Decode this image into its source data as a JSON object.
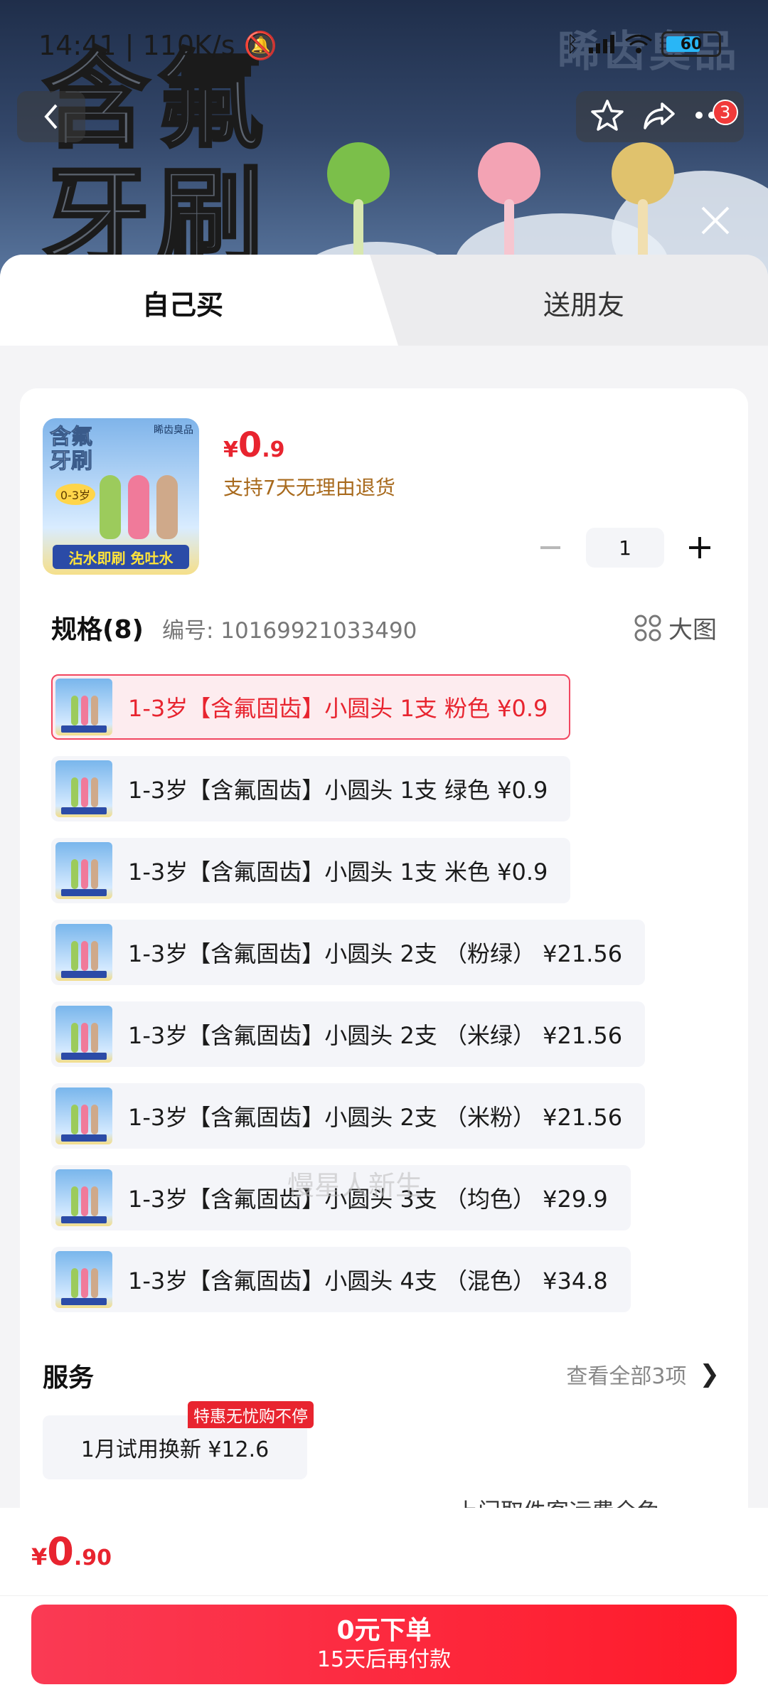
{
  "status_bar": {
    "time": "14:41",
    "speed": "110K/s",
    "battery": "60"
  },
  "banner": {
    "title_line1": "含氟",
    "title_line2": "牙刷",
    "brand": "睎齿臭品"
  },
  "nav": {
    "more_badge": "3"
  },
  "tabs": [
    {
      "label": "自己买"
    },
    {
      "label": "送朋友"
    }
  ],
  "product": {
    "price_currency": "¥",
    "price_int": "0",
    "price_dec": ".9",
    "return_policy": "支持7天无理由退货",
    "quantity": "1",
    "thumb_title_line1": "含氟",
    "thumb_title_line2": "牙刷",
    "thumb_age": "0-3岁",
    "thumb_brand": "睎齿臭品",
    "thumb_banner": "沾水即刷 免吐水"
  },
  "spec": {
    "title": "规格(8)",
    "code": "编号: 10169921033490",
    "big_image": "大图",
    "options": [
      {
        "label": "1-3岁【含氟固齿】小圆头 1支 粉色  ¥0.9"
      },
      {
        "label": "1-3岁【含氟固齿】小圆头 1支 绿色  ¥0.9"
      },
      {
        "label": "1-3岁【含氟固齿】小圆头 1支 米色  ¥0.9"
      },
      {
        "label": "1-3岁【含氟固齿】小圆头 2支 （粉绿）  ¥21.56"
      },
      {
        "label": "1-3岁【含氟固齿】小圆头 2支 （米绿）  ¥21.56"
      },
      {
        "label": "1-3岁【含氟固齿】小圆头 2支 （米粉）  ¥21.56"
      },
      {
        "label": "1-3岁【含氟固齿】小圆头 3支 （均色）  ¥29.9"
      },
      {
        "label": "1-3岁【含氟固齿】小圆头 4支 （混色）  ¥34.8"
      }
    ]
  },
  "watermark": "慢星人新生",
  "service": {
    "title": "服务",
    "view_all": "查看全部3项",
    "chip": "1月试用换新  ¥12.6",
    "tag": "特惠无忧购不停"
  },
  "bottom": {
    "peek_text": "上门取件客运费全免",
    "total_currency": "¥",
    "total_int": "0",
    "total_dec": ".90",
    "cta_main": "0元下单",
    "cta_sub": "15天后再付款"
  },
  "colors": {
    "accent": "#e8242f",
    "return_text": "#a86a1d",
    "option_bg": "#f4f5f9"
  }
}
